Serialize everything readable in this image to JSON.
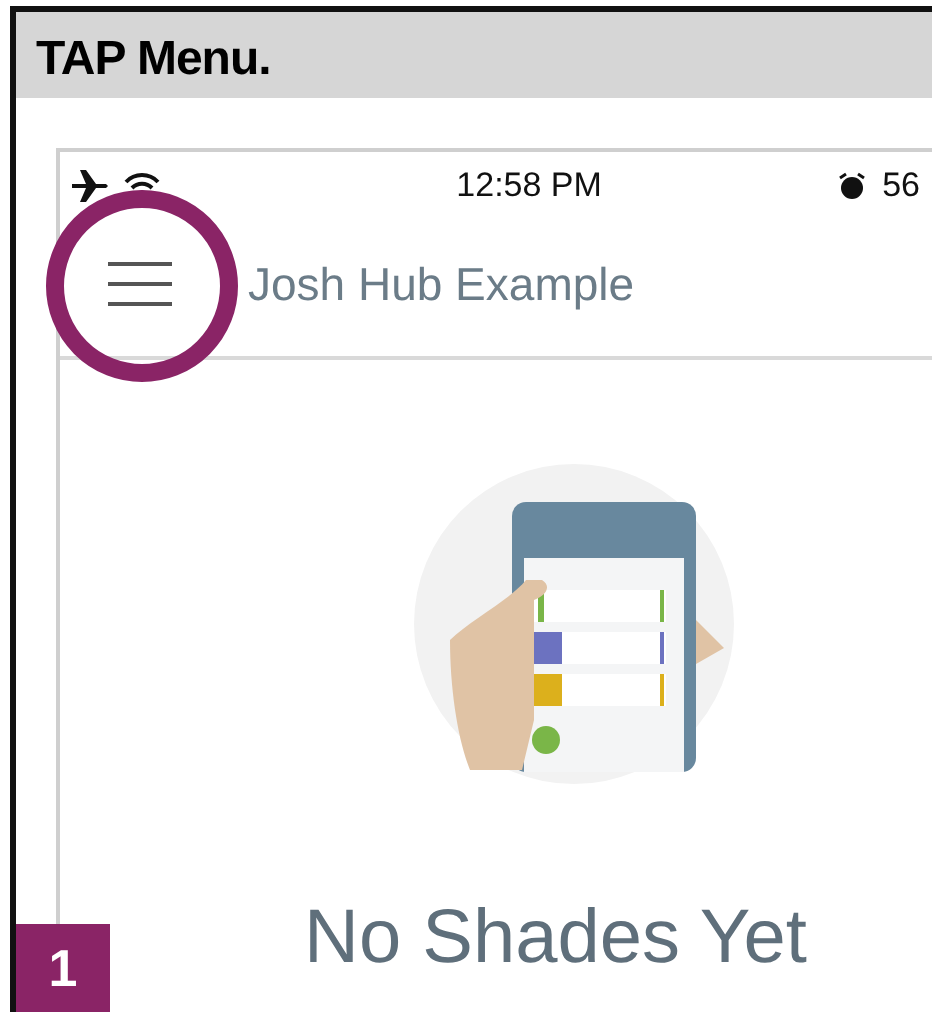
{
  "header": {
    "title": "TAP Menu."
  },
  "status_bar": {
    "time": "12:58 PM",
    "battery": "56"
  },
  "app_bar": {
    "title": "Josh Hub Example"
  },
  "empty_state": {
    "message": "No Shades Yet"
  },
  "step": {
    "number": "1"
  }
}
